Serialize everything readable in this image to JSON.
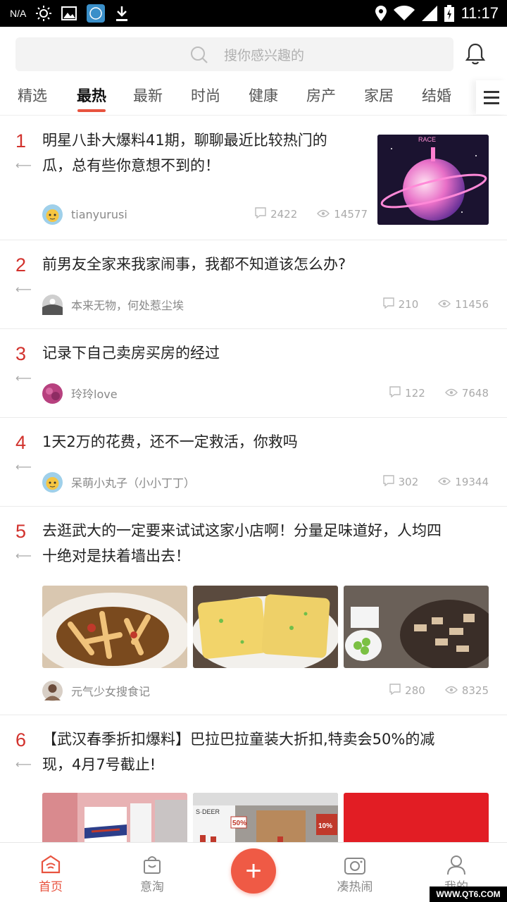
{
  "status_bar": {
    "carrier": "N/A",
    "time": "11:17"
  },
  "search": {
    "placeholder": "搜你感兴趣的"
  },
  "tabs": [
    "精选",
    "最热",
    "最新",
    "时尚",
    "健康",
    "房产",
    "家居",
    "结婚"
  ],
  "active_tab": "最热",
  "feed": [
    {
      "rank": "1",
      "title_lines": [
        "明星八卦大爆料41期，聊聊最近比较热门的",
        "瓜，总有些你意想不到的！"
      ],
      "author": "tianyurusi",
      "comments": "2422",
      "views": "14577",
      "cover_text": "RACE"
    },
    {
      "rank": "2",
      "title_lines": [
        "前男友全家来我家闹事，我都不知道该怎么办?"
      ],
      "author": "本来无物，何处惹尘埃",
      "comments": "210",
      "views": "11456"
    },
    {
      "rank": "3",
      "title_lines": [
        "记录下自己卖房买房的经过"
      ],
      "author": "玲玲love",
      "comments": "122",
      "views": "7648"
    },
    {
      "rank": "4",
      "title_lines": [
        "1天2万的花费，还不一定救活，你救吗"
      ],
      "author": "呆萌小丸子（小小丁丁）",
      "comments": "302",
      "views": "19344"
    },
    {
      "rank": "5",
      "title_lines": [
        "去逛武大的一定要来试试这家小店啊！分量足味道好，人均四",
        "十绝对是扶着墙出去！"
      ],
      "author": "元气少女搜食记",
      "comments": "280",
      "views": "8325"
    },
    {
      "rank": "6",
      "title_lines": [
        "【武汉春季折扣爆料】巴拉巴拉童装大折扣,特卖会50%的减",
        "现，4月7号截止!"
      ],
      "image_texts": [
        "S·DEER",
        "50%",
        "10%"
      ]
    }
  ],
  "bottom_nav": [
    {
      "label": "首页",
      "icon": "home-icon",
      "active": true
    },
    {
      "label": "意淘",
      "icon": "shopping-bag-icon",
      "active": false
    },
    {
      "label": "+",
      "icon": "plus-icon",
      "active": false
    },
    {
      "label": "凑热闹",
      "icon": "camera-icon",
      "active": false
    },
    {
      "label": "我的",
      "icon": "user-icon",
      "active": false
    }
  ],
  "watermark": "WWW.QT6.COM",
  "colors": {
    "accent": "#e8533f",
    "rank": "#d2322d",
    "muted": "#888888"
  }
}
